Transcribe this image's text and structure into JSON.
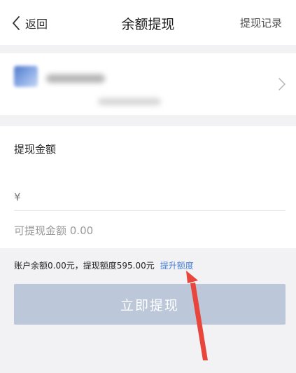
{
  "nav": {
    "back_label": "返回",
    "title": "余额提现",
    "right_action": "提现记录"
  },
  "withdraw": {
    "amount_label": "提现金额",
    "currency_symbol": "¥",
    "amount_value": "",
    "available_label": "可提现金额 0.00"
  },
  "balance": {
    "info_text": "账户余额0.00元，提现额度595.00元",
    "raise_link": "提升额度"
  },
  "submit": {
    "label": "立即提现"
  },
  "colors": {
    "accent_link": "#4a7fd6",
    "button_disabled": "#bcc7da",
    "annotation_arrow": "#e8453c"
  },
  "icons": {
    "back": "chevron-left-icon",
    "card_forward": "chevron-right-icon",
    "bank_logo": "bank-logo-icon"
  }
}
